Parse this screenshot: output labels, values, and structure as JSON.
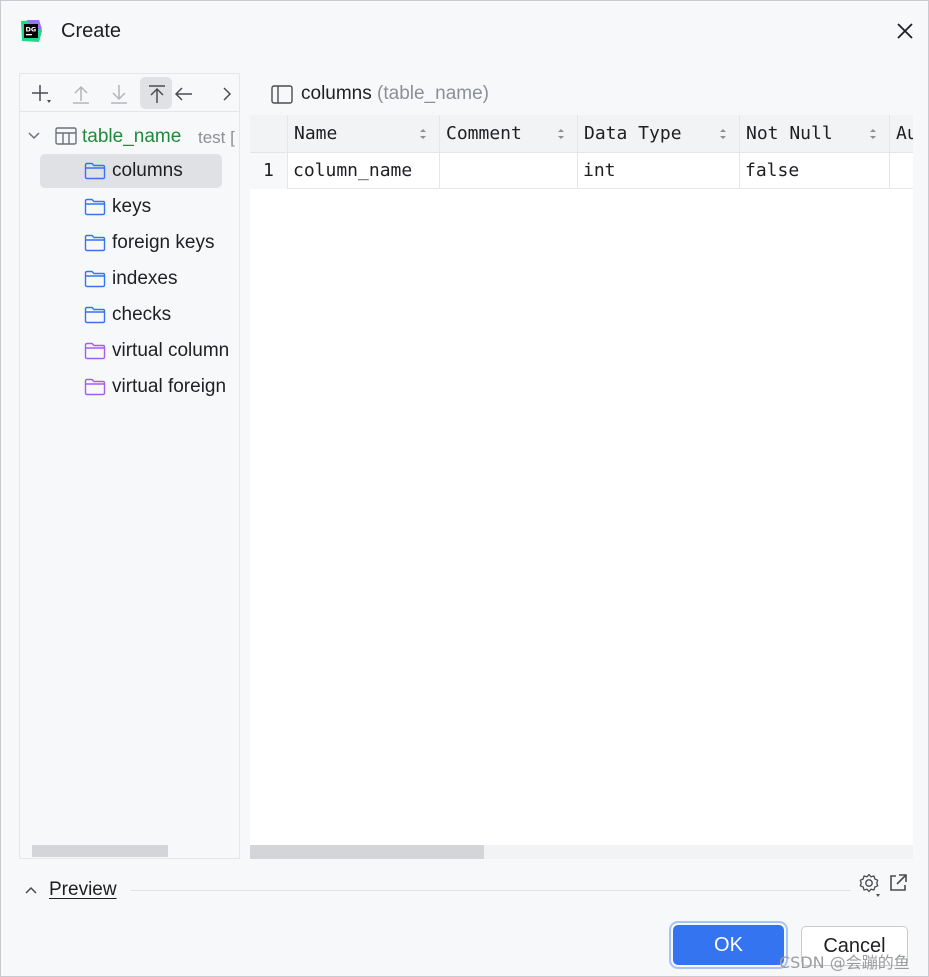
{
  "window": {
    "title": "Create"
  },
  "tree": {
    "root_label": "table_name",
    "root_extra": "test [",
    "items": [
      {
        "label": "columns",
        "kind": "normal",
        "selected": true
      },
      {
        "label": "keys",
        "kind": "normal"
      },
      {
        "label": "foreign keys",
        "kind": "normal"
      },
      {
        "label": "indexes",
        "kind": "normal"
      },
      {
        "label": "checks",
        "kind": "normal"
      },
      {
        "label": "virtual column",
        "kind": "virtual"
      },
      {
        "label": "virtual foreign",
        "kind": "virtual"
      }
    ]
  },
  "right_header": {
    "title": "columns",
    "subtitle": "(table_name)"
  },
  "grid": {
    "columns": [
      "Name",
      "Comment",
      "Data Type",
      "Not Null",
      "Au"
    ],
    "rows": [
      {
        "num": "1",
        "cells": [
          "column_name",
          "",
          "int",
          "false",
          ""
        ]
      }
    ]
  },
  "preview": {
    "label": "Preview"
  },
  "buttons": {
    "ok": "OK",
    "cancel": "Cancel"
  },
  "watermark": "CSDN @会蹦的鱼",
  "colors": {
    "accent": "#3574f0",
    "folder_normal": "#3574f0",
    "folder_virtual": "#a55df0",
    "root_green": "#208a3c"
  },
  "icons": {
    "app": "datagrip-app-icon",
    "close": "close-icon",
    "add": "add-icon",
    "move_up": "move-up-icon",
    "move_down": "move-down-icon",
    "move_top": "move-to-top-icon",
    "back": "arrow-left-icon",
    "forward": "chevron-right-icon",
    "table": "table-icon",
    "folder": "folder-icon",
    "panel": "panel-toggle-icon",
    "gear": "gear-icon",
    "external": "open-external-icon"
  }
}
